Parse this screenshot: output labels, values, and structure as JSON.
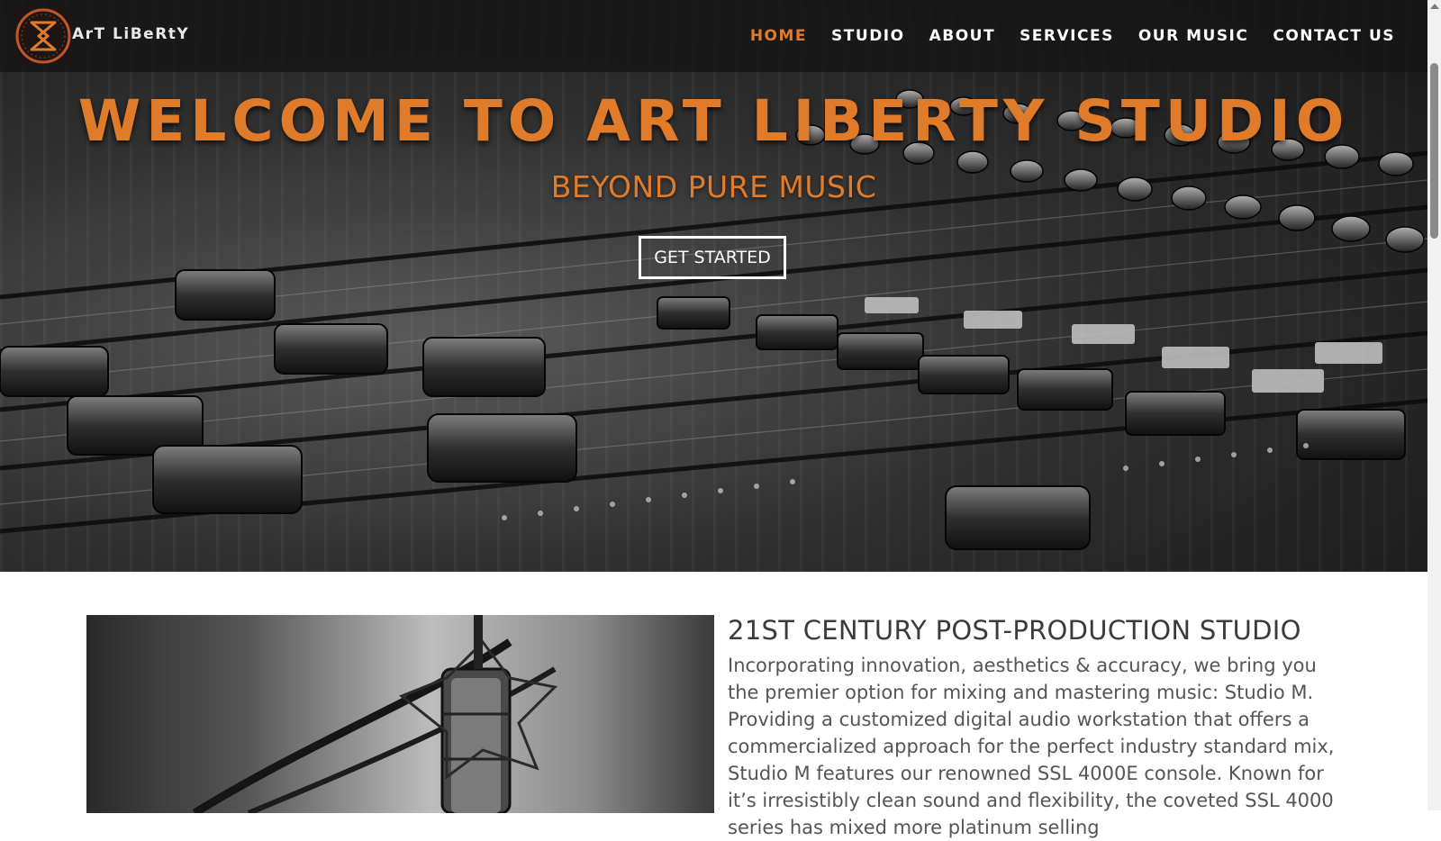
{
  "header": {
    "logo_text": "ArT LiBeRtY",
    "nav": [
      {
        "label": "HOME",
        "active": true
      },
      {
        "label": "STUDIO",
        "active": false
      },
      {
        "label": "ABOUT",
        "active": false
      },
      {
        "label": "SERVICES",
        "active": false
      },
      {
        "label": "OUR MUSIC",
        "active": false
      },
      {
        "label": "CONTACT US",
        "active": false
      }
    ]
  },
  "hero": {
    "title": "WELCOME TO ART LIBERTY STUDIO",
    "subtitle": "BEYOND PURE MUSIC",
    "button_label": "GET STARTED"
  },
  "intro": {
    "title": "21ST CENTURY POST-PRODUCTION STUDIO",
    "body": "Incorporating innovation, aesthetics & accuracy, we bring you the premier option for mixing and mastering music: Studio M. Providing a customized digital audio workstation that offers a commercialized approach for the perfect industry standard mix, Studio M features our renowned SSL 4000E console. Known for it’s irresistibly clean sound and flexibility, the coveted SSL 4000 series has mixed more platinum selling"
  },
  "colors": {
    "accent": "#e07b2a",
    "header_bg": "#161616",
    "text_dark": "#3b3b3b",
    "text_body": "#555555"
  }
}
